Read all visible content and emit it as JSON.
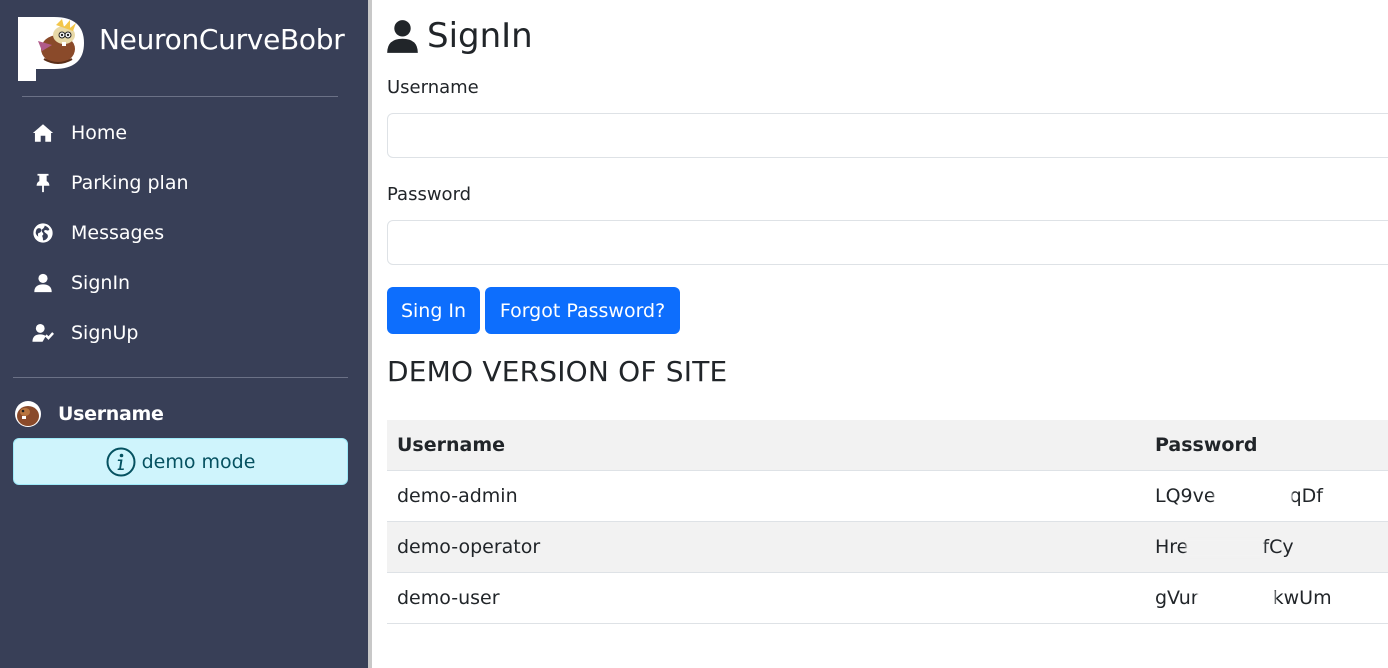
{
  "brand": {
    "name": "NeuronCurveBobr"
  },
  "nav": {
    "items": [
      {
        "label": "Home",
        "icon": "home-icon"
      },
      {
        "label": "Parking plan",
        "icon": "pin-icon"
      },
      {
        "label": "Messages",
        "icon": "globe-icon"
      },
      {
        "label": "SignIn",
        "icon": "user-icon"
      },
      {
        "label": "SignUp",
        "icon": "user-check-icon"
      }
    ]
  },
  "user": {
    "name": "Username",
    "avatar": "beaver-avatar"
  },
  "demo_badge": {
    "label": "demo mode",
    "icon": "info-icon"
  },
  "page": {
    "title": "SignIn",
    "title_icon": "user-icon"
  },
  "form": {
    "username_label": "Username",
    "username_value": "",
    "password_label": "Password",
    "password_value": "",
    "signin_button": "Sing In",
    "forgot_button": "Forgot Password?"
  },
  "demo": {
    "heading": "DEMO VERSION OF SITE",
    "columns": [
      "Username",
      "Password"
    ],
    "rows": [
      {
        "username": "demo-admin",
        "pw_start": "LQ9ve",
        "pw_end": "qDf"
      },
      {
        "username": "demo-operator",
        "pw_start": "Hre",
        "pw_end": "fCy"
      },
      {
        "username": "demo-user",
        "pw_start": "gVur",
        "pw_end": "kwUm"
      }
    ]
  },
  "colors": {
    "sidebar_bg": "#383f57",
    "primary": "#0d6efd",
    "info_bg": "#cff4fc",
    "info_text": "#055160"
  }
}
